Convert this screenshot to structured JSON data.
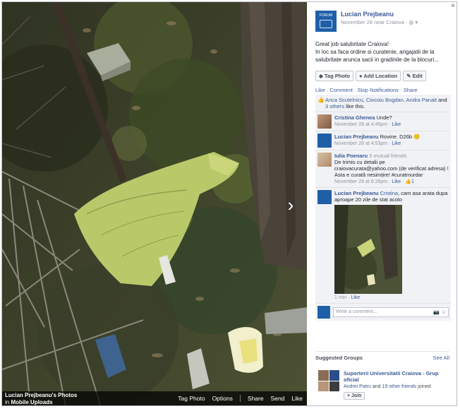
{
  "photo_bar": {
    "album_title": "Lucian Prejbeanu's Photos",
    "album_in": "in",
    "album_name": "Mobile Uploads",
    "actions": [
      "Tag Photo",
      "Options",
      "Share",
      "Send",
      "Like"
    ]
  },
  "post": {
    "author": "Lucian Prejbeanu",
    "date": "November 28 near Craiova",
    "privacy_icon": "globe-icon",
    "text_line1": "Great job salubritate Craiova!",
    "text_line2": "In loc sa faca ordine si curatenie, angajatii de la salubritate arunca sacii in gradinile de la blocuri...",
    "buttons": {
      "tag": "Tag Photo",
      "location": "Add Location",
      "edit": "Edit"
    },
    "links": {
      "like": "Like",
      "comment": "Comment",
      "stop": "Stop Notifications",
      "share": "Share"
    }
  },
  "likes": {
    "names": "Anca Scutelnicu, Ciocoiu Bogdan, Andra Panait",
    "and": "and",
    "others": "3 others",
    "suffix": "like this."
  },
  "comments": [
    {
      "name": "Cristina Ghenea",
      "text": "Unde?",
      "time": "November 28 at 4:45pm",
      "like": "Like"
    },
    {
      "name": "Lucian Prejbeanu",
      "text": "Rovine. D26b 🙂",
      "time": "November 28 at 4:53pm",
      "like": "Like"
    },
    {
      "name": "Iulia Poenaru",
      "mutual": "5 mutual friends",
      "text": "De trimis cu detalii pe craiovacurata@yahoo.com (de verificat adresa) ! Asta e curată nesimțire! #curatmurdar",
      "time": "November 28 at 6:28pm",
      "like": "Like",
      "likes_count": "1"
    },
    {
      "name": "Lucian Prejbeanu",
      "mention": "Cristina",
      "text": ", cam asa arata dupa aproape 20 zile de stat acolo",
      "time": "1 min",
      "like": "Like"
    }
  ],
  "write_comment": {
    "placeholder": "Write a comment..."
  },
  "suggested": {
    "heading": "Suggested Groups",
    "see_all": "See All",
    "group_name": "Suporterii Universitatii Craiova - Grup oficial",
    "joined_names": "Andrei Patru",
    "joined_and": "and",
    "joined_others": "19 other friends",
    "joined_suffix": "joined",
    "join_label": "+ Join"
  },
  "colors": {
    "link": "#3b5998",
    "page_logo": "#1f5fa8",
    "bag": "#b9c96a"
  }
}
